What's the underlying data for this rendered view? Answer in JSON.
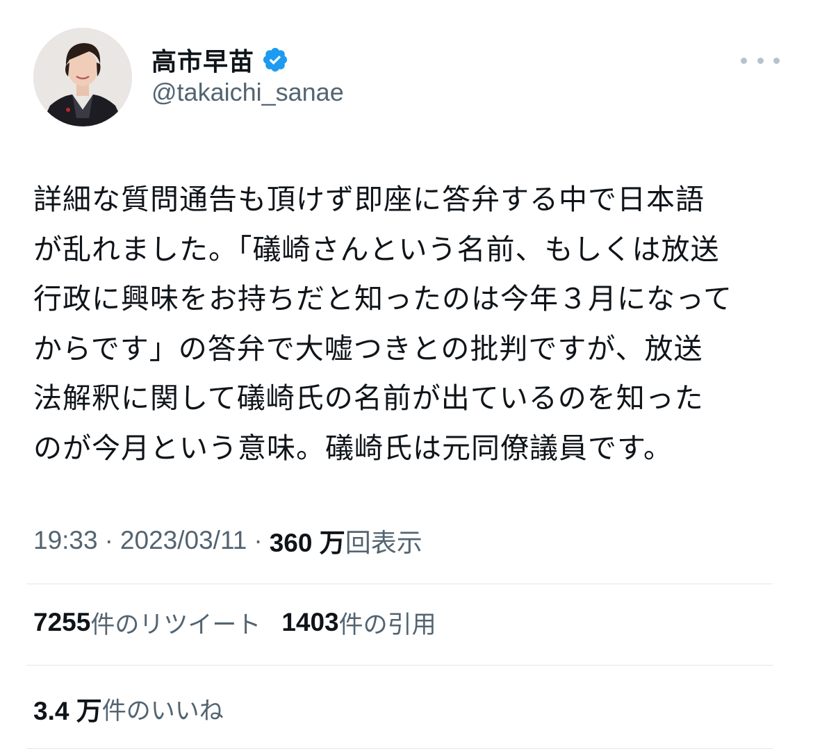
{
  "author": {
    "display_name": "高市早苗",
    "handle": "@takaichi_sanae",
    "verified_icon": "verified-badge-icon",
    "badge_color": "#1d9bf0"
  },
  "tweet": {
    "lines": [
      "詳細な質問通告も頂けず即座に答弁する中で日本語",
      "が乱れました。「礒崎さんという名前、もしくは放送",
      "行政に興味をお持ちだと知ったのは今年３月になって",
      "からです」の答弁で大嘘つきとの批判ですが、放送",
      "法解釈に関して礒崎氏の名前が出ているのを知った",
      "のが今月という意味。礒崎氏は元同僚議員です。"
    ]
  },
  "meta": {
    "time": "19:33",
    "separator": "·",
    "date": "2023/03/11",
    "views_count": "360 万",
    "views_label": "回表示"
  },
  "stats": {
    "retweets_count": "7255",
    "retweets_label": "件のリツイート",
    "quotes_count": "1403",
    "quotes_label": "件の引用",
    "likes_count": "3.4 万",
    "likes_label": "件のいいね"
  },
  "colors": {
    "text_primary": "#0f1419",
    "text_secondary": "#536471",
    "divider": "#e1e6ea"
  }
}
